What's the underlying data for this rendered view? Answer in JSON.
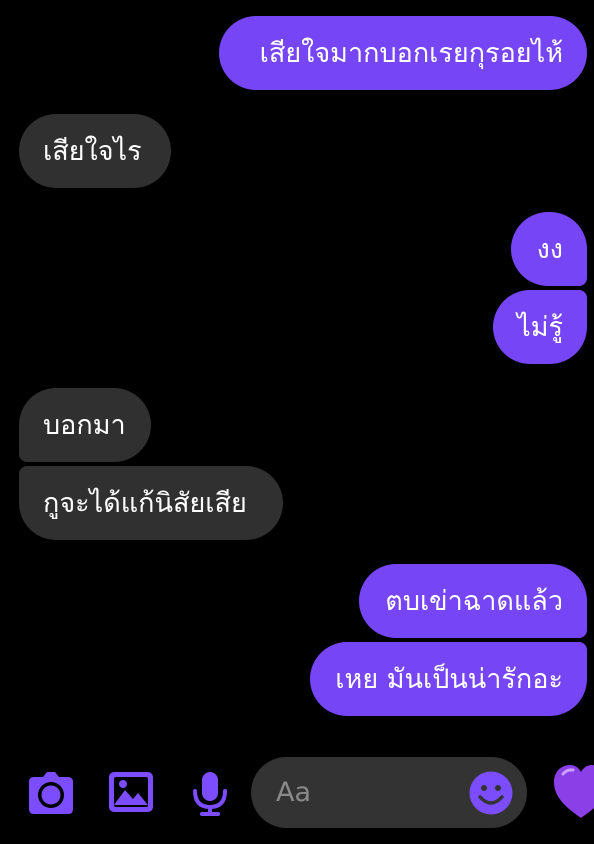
{
  "colors": {
    "outgoing_bubble": "#7646f6",
    "incoming_bubble": "#303030",
    "accent": "#7c4dff",
    "background": "#000000",
    "composer": "#333333"
  },
  "messages": [
    {
      "direction": "outgoing",
      "text": "เสียใจมากบอกเรยกุรอยไห้"
    },
    {
      "direction": "incoming",
      "text": "เสียใจไร"
    },
    {
      "direction": "outgoing",
      "text": "งง"
    },
    {
      "direction": "outgoing",
      "text": "ไม่รู้"
    },
    {
      "direction": "incoming",
      "text": "บอกมา"
    },
    {
      "direction": "incoming",
      "text": "กูจะได้แก้นิสัยเสีย"
    },
    {
      "direction": "outgoing",
      "text": "ตบเข่าฉาดแล้ว"
    },
    {
      "direction": "outgoing",
      "text": "เหย มันเป็นน่ารักอะ"
    }
  ],
  "composer": {
    "placeholder": "Aa",
    "value": ""
  },
  "icons": {
    "camera": "camera-icon",
    "gallery": "image-gallery-icon",
    "microphone": "microphone-icon",
    "emoji": "emoji-smile-icon",
    "reaction": "purple-heart-icon"
  }
}
